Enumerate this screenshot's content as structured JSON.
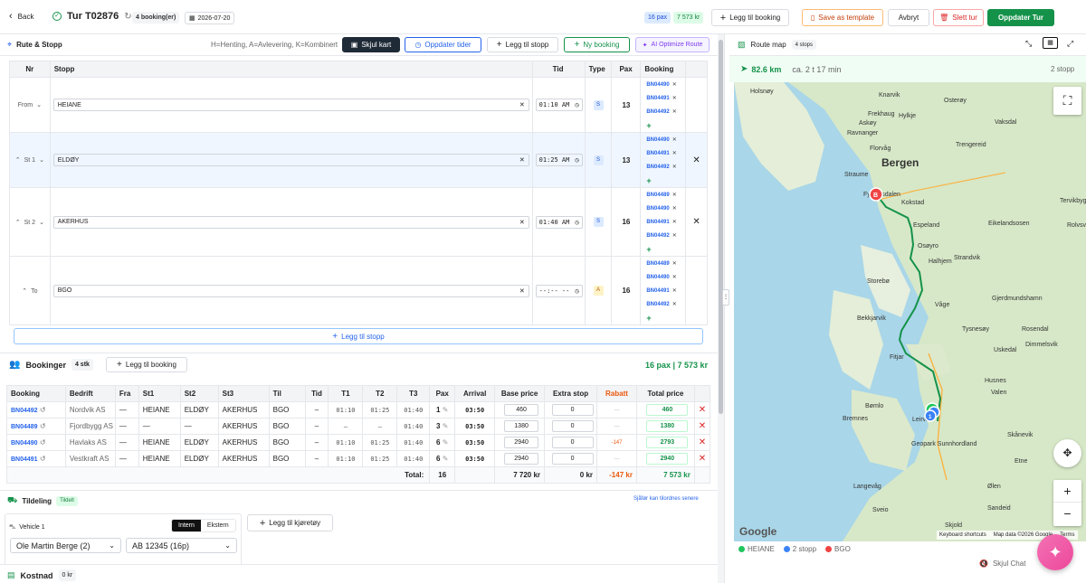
{
  "topbar": {
    "back_label": "Back",
    "title": "Tur T02876",
    "bookings_badge": "4 booking(er)",
    "date": "2026-07-20",
    "pax_badge": "16 pax",
    "amount_badge": "7 573 kr",
    "add_booking_label": "Legg til booking",
    "save_template_label": "Save as template",
    "cancel_label": "Avbryt",
    "delete_label": "Slett tur",
    "update_label": "Oppdater Tur"
  },
  "route": {
    "title": "Rute & Stopp",
    "legend_hint": "H=Henting, A=Avlevering, K=Kombinert",
    "hide_map_label": "Skjul kart",
    "update_times_label": "Oppdater tider",
    "add_stop_label": "Legg til stopp",
    "new_booking_label": "Ny booking",
    "ai_label": "AI Optimize Route",
    "headers": [
      "Nr",
      "Stopp",
      "Tid",
      "Type",
      "Pax",
      "Booking"
    ],
    "stops": [
      {
        "nr": "From",
        "name": "HEIANE",
        "time": "01:10 AM",
        "type": "S",
        "pax": "13",
        "bookings": [
          "BN04490",
          "BN04491",
          "BN04492"
        ],
        "removable": false
      },
      {
        "nr": "St 1",
        "name": "ELDØY",
        "time": "01:25 AM",
        "type": "S",
        "pax": "13",
        "bookings": [
          "BN04490",
          "BN04491",
          "BN04492"
        ],
        "removable": true
      },
      {
        "nr": "St 2",
        "name": "AKERHUS",
        "time": "01:40 AM",
        "type": "S",
        "pax": "16",
        "bookings": [
          "BN04489",
          "BN04490",
          "BN04491",
          "BN04492"
        ],
        "removable": true
      },
      {
        "nr": "To",
        "name": "BGO",
        "time": "--:-- --",
        "type": "A",
        "pax": "16",
        "bookings": [
          "BN04489",
          "BN04490",
          "BN04491",
          "BN04492"
        ],
        "removable": false
      }
    ],
    "add_stop_bottom_label": "Legg til stopp"
  },
  "bookings": {
    "title": "Bookinger",
    "count_badge": "4 stk",
    "add_label": "Legg til booking",
    "summary": "16 pax | 7 573 kr",
    "headers": [
      "Booking",
      "Bedrift",
      "Fra",
      "St1",
      "St2",
      "St3",
      "Til",
      "Tid",
      "T1",
      "T2",
      "T3",
      "Pax",
      "Arrival",
      "Base price",
      "Extra stop",
      "Rabatt",
      "Total price"
    ],
    "rows": [
      {
        "id": "BN04492",
        "company": "Nordvik AS",
        "fra": "—",
        "st1": "HEIANE",
        "st2": "ELDØY",
        "st3": "AKERHUS",
        "til": "BGO",
        "tid": "–",
        "t1": "01:10",
        "t2": "01:25",
        "t3": "01:40",
        "pax": "1",
        "arrival": "03:50",
        "base": "460",
        "extra": "0",
        "rabatt": "—",
        "total": "460"
      },
      {
        "id": "BN04489",
        "company": "Fjordbygg AS",
        "fra": "—",
        "st1": "—",
        "st2": "—",
        "st3": "AKERHUS",
        "til": "BGO",
        "tid": "–",
        "t1": "–",
        "t2": "–",
        "t3": "01:40",
        "pax": "3",
        "arrival": "03:50",
        "base": "1380",
        "extra": "0",
        "rabatt": "—",
        "total": "1380"
      },
      {
        "id": "BN04490",
        "company": "Havlaks AS",
        "fra": "—",
        "st1": "HEIANE",
        "st2": "ELDØY",
        "st3": "AKERHUS",
        "til": "BGO",
        "tid": "–",
        "t1": "01:10",
        "t2": "01:25",
        "t3": "01:40",
        "pax": "6",
        "arrival": "03:50",
        "base": "2940",
        "extra": "0",
        "rabatt": "-147",
        "total": "2793"
      },
      {
        "id": "BN04491",
        "company": "Vestkraft AS",
        "fra": "—",
        "st1": "HEIANE",
        "st2": "ELDØY",
        "st3": "AKERHUS",
        "til": "BGO",
        "tid": "–",
        "t1": "01:10",
        "t2": "01:25",
        "t3": "01:40",
        "pax": "6",
        "arrival": "03:50",
        "base": "2940",
        "extra": "0",
        "rabatt": "—",
        "total": "2940"
      }
    ],
    "total_label": "Total:",
    "total_pax": "16",
    "total_base": "7 720 kr",
    "total_extra": "0 kr",
    "total_rabatt": "-147 kr",
    "total_price": "7 573 kr"
  },
  "assignment": {
    "title": "Tildeling",
    "status_badge": "Tildelt",
    "driver_note": "Sjåfør kan tilordnes senere",
    "vehicle_label": "Vehicle 1",
    "intern_label": "Intern",
    "ekstern_label": "Ekstern",
    "driver": "Ole Martin Berge (2)",
    "vehicle": "AB 12345 (16p)",
    "add_vehicle_label": "Legg til kjøretøy"
  },
  "cost": {
    "title": "Kostnad",
    "amount": "0 kr"
  },
  "map": {
    "title": "Route map",
    "stops_badge": "4 stops",
    "distance": "82.6 km",
    "duration": "ca. 2 t 17 min",
    "stop_count": "2 stopp",
    "places": [
      "Holsnøy",
      "Knarvik",
      "Frekhaug",
      "Hylkje",
      "Osterøy",
      "Vaksdal",
      "Askøy",
      "Ravnanger",
      "Florvåg",
      "Trengereid",
      "Straume",
      "Bergen",
      "Fyllingsdalen",
      "Kokstad",
      "Espeland",
      "Eikelandsosen",
      "Osøyro",
      "Halhjem",
      "Strandvik",
      "Storebø",
      "Våge",
      "Gjerdmundshamn",
      "Bekkjarvik",
      "Tysnesøy",
      "Rosendal",
      "Uskedal",
      "Dimmelsvik",
      "Fitjar",
      "Husnes",
      "Valen",
      "Bømlo",
      "Leirvik",
      "Bremnes",
      "Geopark Sunnhordland",
      "Skånevik",
      "Etne",
      "Langevåg",
      "Ølen",
      "Sandeid",
      "Sveio",
      "Skjold",
      "Tervikbygd",
      "Rolvsvåg"
    ],
    "attribution": "Google",
    "keyboard": "Keyboard shortcuts",
    "mapdata": "Map data ©2026 Google",
    "terms": "Terms",
    "legend": [
      "HEIANE",
      "2 stopp",
      "BGO"
    ],
    "legend_colors": [
      "#22c55e",
      "#3b82f6",
      "#ef4444"
    ],
    "marker_b": "B",
    "marker_1": "1",
    "hide_chat": "Skjul Chat"
  }
}
